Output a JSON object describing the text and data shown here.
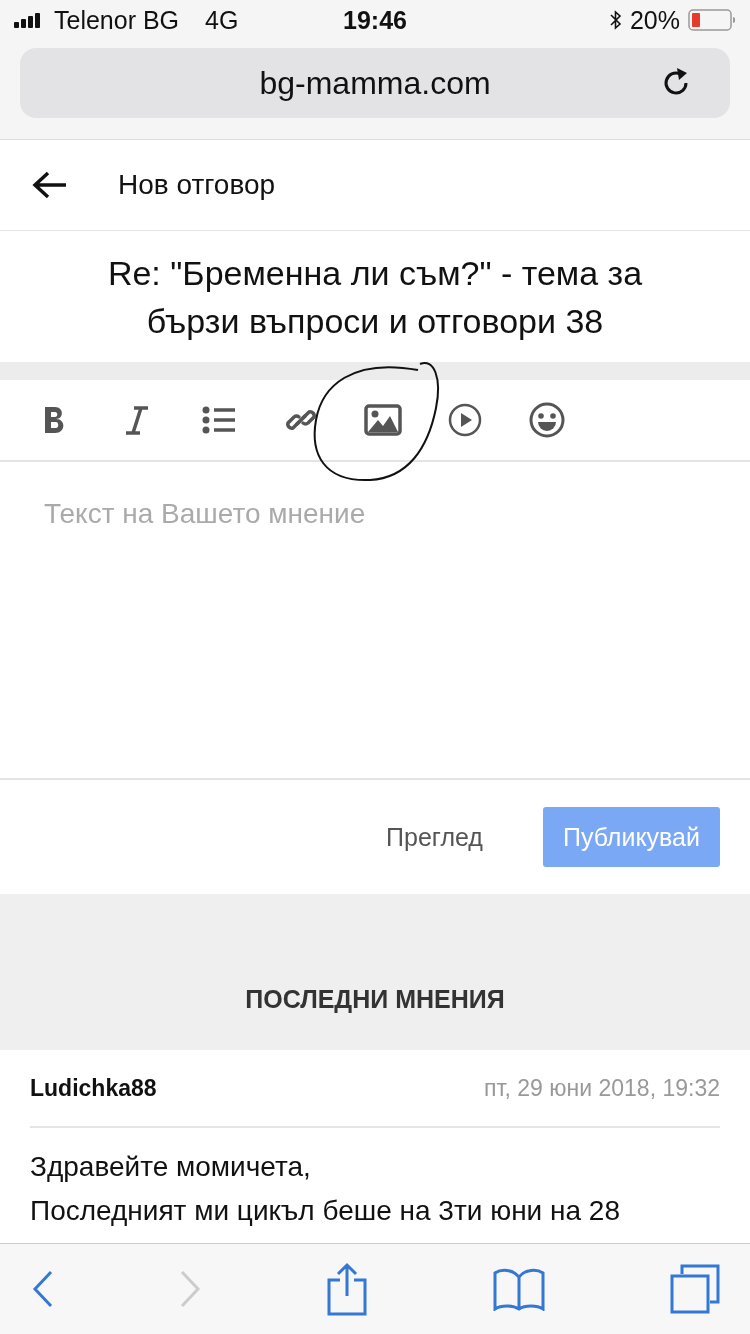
{
  "status_bar": {
    "carrier": "Telenor BG",
    "network": "4G",
    "time": "19:46",
    "battery": "20%"
  },
  "address_bar": {
    "url": "bg-mamma.com"
  },
  "header": {
    "title": "Нов отговор"
  },
  "topic_title": "Re: \"Бременна ли съм?\" - тема за бързи въпроси и отговори 38",
  "editor": {
    "tools": [
      {
        "kind": "bold"
      },
      {
        "kind": "italic"
      },
      {
        "kind": "list"
      },
      {
        "kind": "link"
      },
      {
        "kind": "image"
      },
      {
        "kind": "video"
      },
      {
        "kind": "emoji"
      }
    ],
    "placeholder": "Текст на Вашето мнение"
  },
  "actions": [
    {
      "label": "Преглед",
      "kind": "secondary"
    },
    {
      "label": "Публикувай",
      "kind": "primary"
    }
  ],
  "latest": {
    "heading": "ПОСЛЕДНИ МНЕНИЯ",
    "posts": [
      {
        "author": "Ludichka88",
        "date": "пт, 29 юни 2018, 19:32",
        "lines": [
          "Здравейте момичета,",
          "Последният ми цикъл беше на 3ти юни на 28"
        ]
      }
    ]
  },
  "browser_toolbar": [
    {
      "kind": "back",
      "disabled": false
    },
    {
      "kind": "forward",
      "disabled": true
    },
    {
      "kind": "share",
      "disabled": false
    },
    {
      "kind": "bookmarks",
      "disabled": false
    },
    {
      "kind": "tabs",
      "disabled": false
    }
  ]
}
